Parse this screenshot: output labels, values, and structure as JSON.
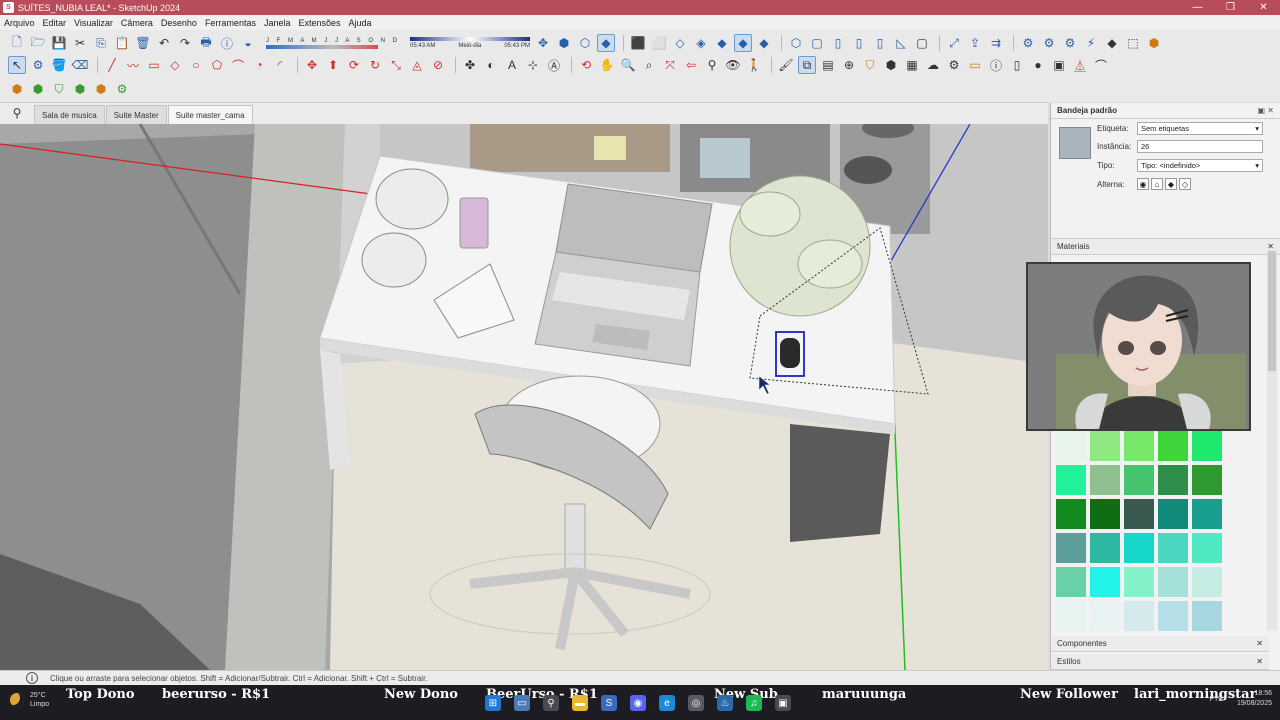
{
  "window": {
    "title": "SUÍTES_NUBIA LEAL* - SketchUp 2024",
    "controls": [
      "—",
      "❐",
      "✕"
    ]
  },
  "menu": [
    "Arquivo",
    "Editar",
    "Visualizar",
    "Câmera",
    "Desenho",
    "Ferramentas",
    "Janela",
    "Extensões",
    "Ajuda"
  ],
  "shadows": {
    "months": "J F M A M J J A S O N D",
    "time_start": "05:43 AM",
    "time_mid": "Meio-dia",
    "time_end": "05:43 PM"
  },
  "scene_tabs": [
    "Sala de musica",
    "Suite Master",
    "Suite master_cama"
  ],
  "active_scene_index": 2,
  "tray": {
    "title": "Bandeja padrão",
    "entity_info": {
      "tag_label": "Etiqueta:",
      "tag_value": "Sem etiquetas",
      "instance_label": "Instância:",
      "instance_value": "26",
      "type_label": "Tipo:",
      "type_value": "Tipo: <indefinido>",
      "toggle_label": "Alterna:"
    },
    "materials_label": "Materiais",
    "components_label": "Componentes",
    "styles_label": "Estilos",
    "swatch_colors": [
      "#e8f5ea",
      "#8fe87f",
      "#78e86a",
      "#3fd43a",
      "#1ee86e",
      "#23f29a",
      "#8fbf8f",
      "#45c46f",
      "#2f8f4a",
      "#2f9a2f",
      "#128a1e",
      "#0f6e14",
      "#3a5a50",
      "#128a7a",
      "#1a9e8e",
      "#5e9e9a",
      "#2eb8a2",
      "#16d6c8",
      "#4ad6c0",
      "#4ee8c2",
      "#6ad0a8",
      "#22f2e8",
      "#86f0c8",
      "#a6e0da",
      "#c6ece6",
      "#e6f4f2",
      "#e8f2f2",
      "#d6eaee",
      "#b6e0e8",
      "#a6d6e0"
    ]
  },
  "status": {
    "message": "Clique ou arraste para selecionar objetos. Shift = Adicionar/Subtrair. Ctrl = Adicionar. Shift + Ctrl = Subtrair."
  },
  "taskbar": {
    "temperature": "25°C",
    "weather": "Limpo",
    "lang": "PTB",
    "time": "18:56",
    "date": "19/08/2025",
    "ticker": [
      {
        "label": "Top Dono",
        "value": "beerurso - R$1"
      },
      {
        "label": "New Dono",
        "value": "BeerUrso - R$1"
      },
      {
        "label": "New Sub",
        "value": "maruuunga"
      },
      {
        "label": "New Follower",
        "value": "lari_morningstar"
      }
    ]
  },
  "colors": {
    "title_bar": "#b84c5a",
    "axis_red": "#d42020",
    "axis_green": "#20c020",
    "axis_blue": "#2030d0",
    "selection": "#1a24c8"
  }
}
